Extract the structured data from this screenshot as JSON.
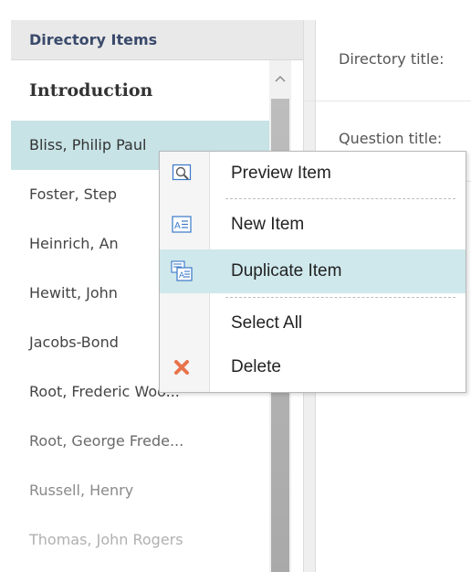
{
  "left_panel": {
    "header": "Directory Items",
    "items": [
      {
        "label": "Introduction"
      },
      {
        "label": "Bliss, Philip Paul"
      },
      {
        "label": "Foster, Step"
      },
      {
        "label": "Heinrich, An"
      },
      {
        "label": "Hewitt, John"
      },
      {
        "label": "Jacobs-Bond"
      },
      {
        "label": "Root, Frederic Woo..."
      },
      {
        "label": "Root, George Frede..."
      },
      {
        "label": "Russell, Henry"
      },
      {
        "label": "Thomas, John Rogers"
      }
    ],
    "scroll_up_glyph": "^"
  },
  "right_panel": {
    "directory_title_label": "Directory title:",
    "question_title_label": "Question title:"
  },
  "context_menu": {
    "items": [
      {
        "label": "Preview Item",
        "icon": "preview-icon"
      },
      {
        "label": "New Item",
        "icon": "new-item-icon"
      },
      {
        "label": "Duplicate Item",
        "icon": "duplicate-icon"
      },
      {
        "label": "Select All",
        "icon": ""
      },
      {
        "label": "Delete",
        "icon": "delete-icon"
      }
    ],
    "highlighted_index": 2
  },
  "colors": {
    "selected_row": "#c7e3e6",
    "menu_highlight": "#cfe8ec",
    "header_text": "#3a4a6b",
    "delete_icon": "#e8734a",
    "icon_blue": "#3a78c9"
  }
}
